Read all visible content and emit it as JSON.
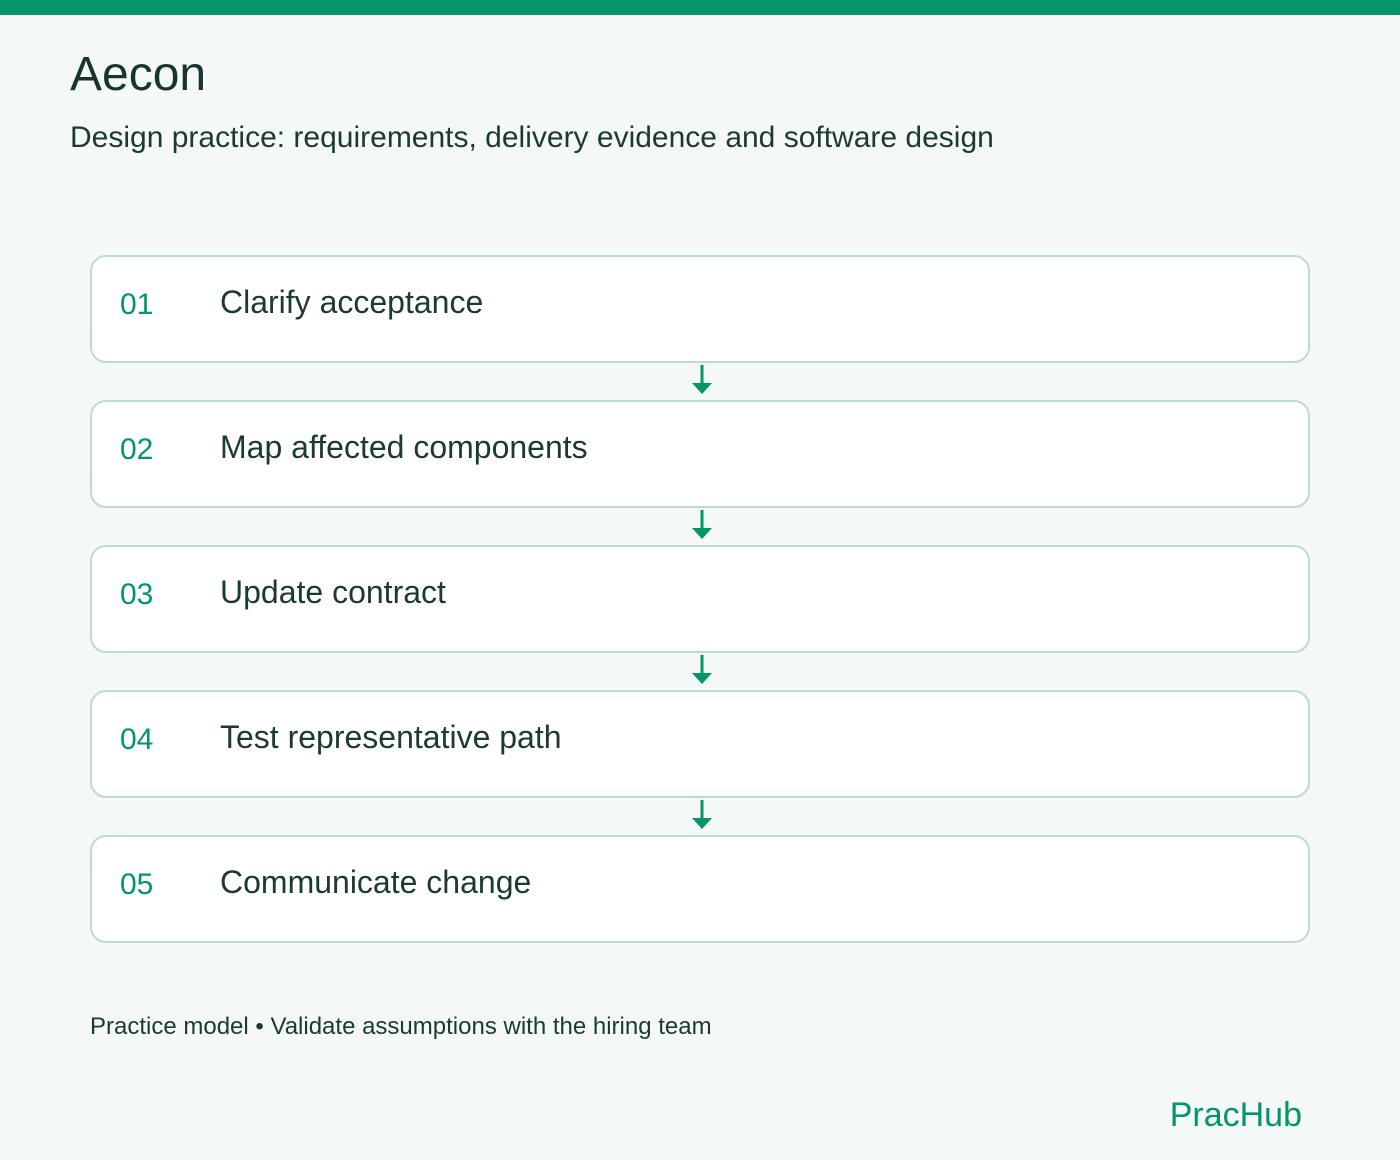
{
  "header": {
    "title": "Aecon",
    "subtitle": "Design practice: requirements, delivery evidence and software design"
  },
  "steps": [
    {
      "number": "01",
      "label": "Clarify acceptance"
    },
    {
      "number": "02",
      "label": "Map affected components"
    },
    {
      "number": "03",
      "label": "Update contract"
    },
    {
      "number": "04",
      "label": "Test representative path"
    },
    {
      "number": "05",
      "label": "Communicate change"
    }
  ],
  "footer": {
    "note": "Practice model • Validate assumptions with the hiring team",
    "brand": "PracHub"
  },
  "colors": {
    "accent": "#05956a",
    "background": "#f4f8f6",
    "text": "#1b3a33",
    "card_border": "#bcdccf"
  }
}
